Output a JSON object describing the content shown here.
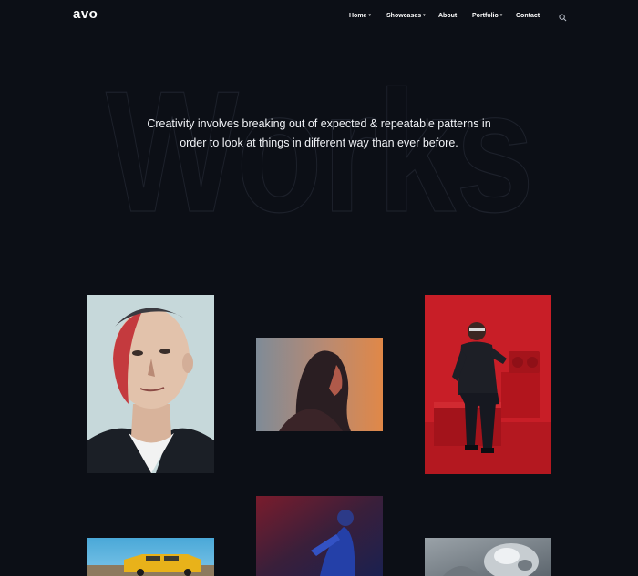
{
  "brand": {
    "logo": "avo"
  },
  "nav": {
    "items": [
      {
        "label": "Home",
        "has_dropdown": true
      },
      {
        "label": "Showcases",
        "has_dropdown": true
      },
      {
        "label": "About",
        "has_dropdown": false
      },
      {
        "label": "Portfolio",
        "has_dropdown": true
      },
      {
        "label": "Contact",
        "has_dropdown": false
      }
    ],
    "search_icon": "search-icon",
    "dropdown_icon": "▾"
  },
  "hero": {
    "background_word": "Works",
    "line1": "Creativity involves breaking out of expected & repeatable patterns in",
    "line2": "order to look at things in different way than ever before."
  },
  "gallery": {
    "items": [
      {
        "subject": "illustrated portrait of man"
      },
      {
        "subject": "woman silhouette in orange light"
      },
      {
        "subject": "man sitting on red box with boombox"
      },
      {
        "subject": "figure in blue and red light"
      },
      {
        "subject": "yellow vintage car"
      },
      {
        "subject": "chrome object close-up"
      }
    ]
  },
  "colors": {
    "background": "#0c0f16",
    "text": "#ffffff",
    "accent_red": "#d0222c"
  }
}
